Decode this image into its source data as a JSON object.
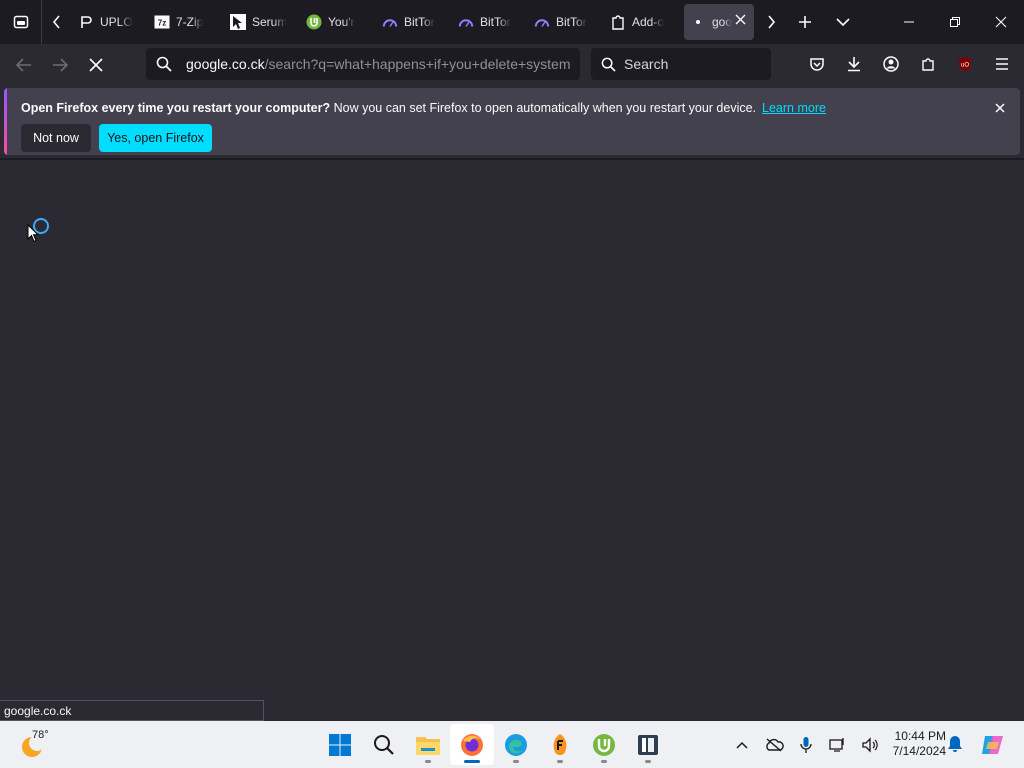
{
  "tabs": [
    {
      "title": "UPLO",
      "icon": "upload-icon"
    },
    {
      "title": "7-Zip",
      "icon": "7zip-icon"
    },
    {
      "title": "Serum",
      "icon": "cursor-icon"
    },
    {
      "title": "You'r",
      "icon": "utorrent-icon"
    },
    {
      "title": "BitTor",
      "icon": "bittorrent-icon"
    },
    {
      "title": "BitTor",
      "icon": "bittorrent-icon"
    },
    {
      "title": "BitTor",
      "icon": "bittorrent-icon"
    },
    {
      "title": "Add-o",
      "icon": "puzzle-icon"
    }
  ],
  "selected_tab": {
    "title": "goo",
    "icon": "loading-dot-icon"
  },
  "url": {
    "host": "google.co.ck",
    "path": "/search?q=what+happens+if+you+delete+system"
  },
  "search": {
    "placeholder": "Search"
  },
  "notification": {
    "bold": "Open Firefox every time you restart your computer?",
    "text": " Now you can set Firefox to open automatically when you restart your device.",
    "link": "Learn more",
    "not_now": "Not now",
    "yes": "Yes, open Firefox"
  },
  "status": "google.co.ck",
  "taskbar": {
    "weather_temp": "78°",
    "apps": [
      "windows-start-icon",
      "search-icon",
      "file-explorer-icon",
      "firefox-icon",
      "edge-icon",
      "fl-studio-icon",
      "utorrent-icon",
      "ida-icon"
    ],
    "time": "10:44 PM",
    "date": "7/14/2024"
  },
  "colors": {
    "accent": "#00ddff",
    "background": "#2b2a33",
    "tabstrip": "#1c1b22"
  }
}
